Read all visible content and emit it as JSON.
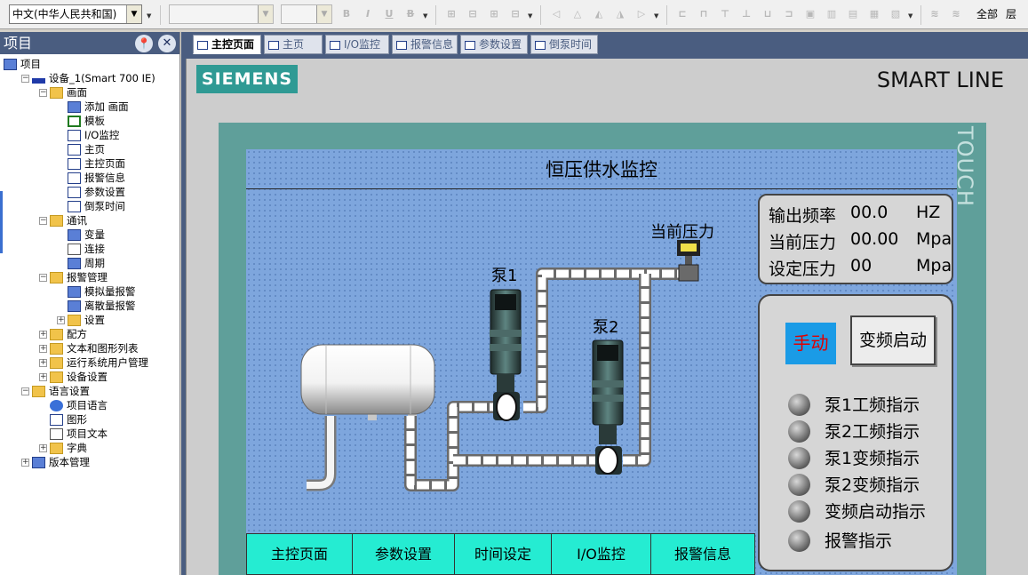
{
  "toolbar": {
    "language": "中文(中华人民共和国)",
    "bold_icon": "B",
    "italic_icon": "I",
    "underline_icon": "U",
    "strike_icon": "B",
    "layer_all": "全部",
    "layer_label": "层"
  },
  "project_panel": {
    "title": "项目",
    "tree": [
      {
        "label": "项目",
        "icon": "project-icon",
        "level": 0,
        "expander": ""
      },
      {
        "label": "设备_1(Smart 700 IE)",
        "icon": "device-icon",
        "level": 1,
        "expander": "−"
      },
      {
        "label": "画面",
        "icon": "folder-icon",
        "level": 2,
        "expander": "−"
      },
      {
        "label": "添加 画面",
        "icon": "add-screen-icon",
        "level": 3,
        "expander": ""
      },
      {
        "label": "模板",
        "icon": "template-icon",
        "level": 3,
        "expander": ""
      },
      {
        "label": "I/O监控",
        "icon": "screen-icon",
        "level": 3,
        "expander": ""
      },
      {
        "label": "主页",
        "icon": "screen-icon",
        "level": 3,
        "expander": ""
      },
      {
        "label": "主控页面",
        "icon": "screen-icon",
        "level": 3,
        "expander": ""
      },
      {
        "label": "报警信息",
        "icon": "screen-icon",
        "level": 3,
        "expander": ""
      },
      {
        "label": "参数设置",
        "icon": "screen-icon",
        "level": 3,
        "expander": ""
      },
      {
        "label": "倒泵时间",
        "icon": "screen-icon",
        "level": 3,
        "expander": ""
      },
      {
        "label": "通讯",
        "icon": "folder-icon",
        "level": 2,
        "expander": "−"
      },
      {
        "label": "变量",
        "icon": "tags-icon",
        "level": 3,
        "expander": ""
      },
      {
        "label": "连接",
        "icon": "connection-icon",
        "level": 3,
        "expander": ""
      },
      {
        "label": "周期",
        "icon": "cycle-icon",
        "level": 3,
        "expander": ""
      },
      {
        "label": "报警管理",
        "icon": "folder-icon",
        "level": 2,
        "expander": "−"
      },
      {
        "label": "模拟量报警",
        "icon": "analog-alarm-icon",
        "level": 3,
        "expander": ""
      },
      {
        "label": "离散量报警",
        "icon": "discrete-alarm-icon",
        "level": 3,
        "expander": ""
      },
      {
        "label": "设置",
        "icon": "folder-icon",
        "level": 3,
        "expander": "+"
      },
      {
        "label": "配方",
        "icon": "folder-icon",
        "level": 2,
        "expander": "+"
      },
      {
        "label": "文本和图形列表",
        "icon": "folder-icon",
        "level": 2,
        "expander": "+"
      },
      {
        "label": "运行系统用户管理",
        "icon": "folder-icon",
        "level": 2,
        "expander": "+"
      },
      {
        "label": "设备设置",
        "icon": "folder-icon",
        "level": 2,
        "expander": "+"
      },
      {
        "label": "语言设置",
        "icon": "folder-icon",
        "level": 1,
        "expander": "−"
      },
      {
        "label": "项目语言",
        "icon": "globe-icon",
        "level": 2,
        "expander": ""
      },
      {
        "label": "图形",
        "icon": "graphics-icon",
        "level": 2,
        "expander": ""
      },
      {
        "label": "项目文本",
        "icon": "text-icon",
        "level": 2,
        "expander": ""
      },
      {
        "label": "字典",
        "icon": "folder-icon",
        "level": 2,
        "expander": "+"
      },
      {
        "label": "版本管理",
        "icon": "version-icon",
        "level": 1,
        "expander": "+"
      }
    ]
  },
  "editor_tabs": [
    "主控页面",
    "主页",
    "I/O监控",
    "报警信息",
    "参数设置",
    "倒泵时间"
  ],
  "hmi": {
    "brand": "SIEMENS",
    "model": "SMART LINE",
    "touch": "TOUCH",
    "screen_title": "恒压供水监控",
    "pump1_label": "泵1",
    "pump2_label": "泵2",
    "pressure_sensor_label": "当前压力",
    "readouts": [
      {
        "label": "输出频率",
        "value": "00.0",
        "unit": "HZ"
      },
      {
        "label": "当前压力",
        "value": "00.00",
        "unit": "Mpa"
      },
      {
        "label": "设定压力",
        "value": "00",
        "unit": "Mpa"
      }
    ],
    "manual_button": "手动",
    "vf_start_button": "变频启动",
    "indicators": [
      "泵1工频指示",
      "泵2工频指示",
      "泵1变频指示",
      "泵2变频指示",
      "变频启动指示",
      "报警指示"
    ],
    "nav_buttons": [
      "主控页面",
      "参数设置",
      "时间设定",
      "I/O监控",
      "报警信息"
    ]
  },
  "colors": {
    "panel_header": "#4a5d80",
    "screen_bg": "#7ea6dd",
    "bezel": "#5f9f9a",
    "nav_button": "#25ecd2",
    "manual_button": "#1a9be6",
    "manual_text": "#e00000"
  }
}
